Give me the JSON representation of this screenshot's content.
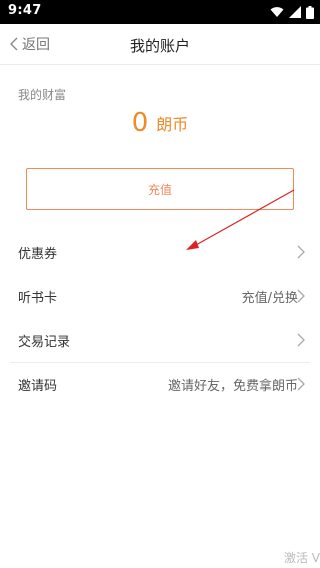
{
  "status": {
    "time": "9:47",
    "icons": [
      "wifi-icon",
      "signal-icon",
      "battery-icon"
    ]
  },
  "header": {
    "back_label": "返回",
    "title": "我的账户"
  },
  "wealth": {
    "label": "我的财富",
    "amount": "0",
    "unit": "朗币"
  },
  "recharge_button": "充值",
  "menu": [
    {
      "label": "优惠券",
      "right": ""
    },
    {
      "label": "听书卡",
      "right": "充值/兑换"
    },
    {
      "label": "交易记录",
      "right": ""
    },
    {
      "label": "邀请码",
      "right": "邀请好友，免费拿朗币"
    }
  ],
  "watermark": "激活 V",
  "colors": {
    "accent": "#f08a2a",
    "button_border": "#f08a5a",
    "annotation": "#e02020"
  }
}
